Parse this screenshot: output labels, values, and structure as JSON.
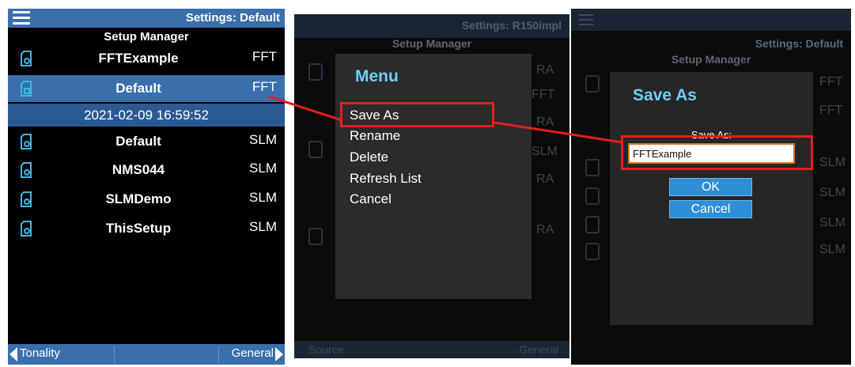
{
  "panel1": {
    "header_title": "Settings: Default",
    "subtitle": "Setup Manager",
    "rows": [
      {
        "name": "FFTExample",
        "mode": "FFT"
      },
      {
        "name": "Default",
        "mode": "FFT"
      },
      {
        "name": "Default",
        "mode": "SLM"
      },
      {
        "name": "NMS044",
        "mode": "SLM"
      },
      {
        "name": "SLMDemo",
        "mode": "SLM"
      },
      {
        "name": "ThisSetup",
        "mode": "SLM"
      }
    ],
    "selected_date": "2021-02-09 16:59:52",
    "footer_left": "Tonality",
    "footer_right": "General"
  },
  "panel2": {
    "header_title": "Settings: R150impl",
    "subtitle": "Setup Manager",
    "bg_modes": [
      "RA",
      "FFT",
      "RA",
      "SLM",
      "RA",
      "RA"
    ],
    "menu_title": "Menu",
    "menu_items": [
      "Save As",
      "Rename",
      "Delete",
      "Refresh List",
      "Cancel"
    ],
    "footer_left": "Source",
    "footer_right": "General"
  },
  "panel3": {
    "header_title": "Settings: Default",
    "subtitle": "Setup Manager",
    "bg_modes": [
      "FFT",
      "FFT",
      "SLM",
      "SLM",
      "SLM",
      "SLM"
    ],
    "dialog_title": "Save As",
    "field_label": "Save As:",
    "field_value": "FFTExample",
    "ok_label": "OK",
    "cancel_label": "Cancel"
  },
  "colors": {
    "header_blue": "#3a6fab",
    "highlight_red": "#e41e1e",
    "accent_cyan": "#6ecff1",
    "button_blue": "#2e8fd6"
  }
}
